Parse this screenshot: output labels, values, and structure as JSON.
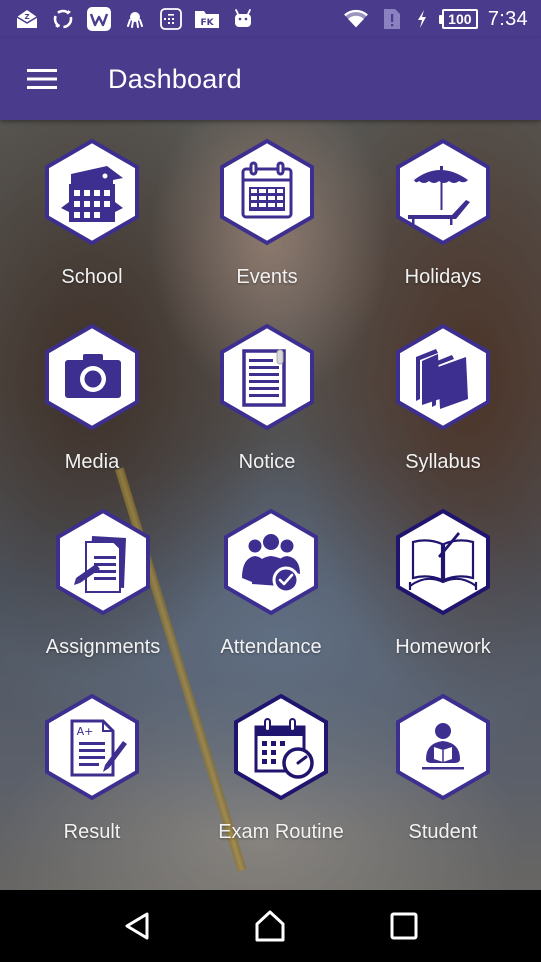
{
  "status_bar": {
    "time": "7:34",
    "battery_level": "100",
    "left_icons": [
      "mail-sync-icon",
      "sync-icon",
      "wps-office-icon",
      "octopus-icon",
      "calculator-icon",
      "fk-folder-icon",
      "android-icon"
    ],
    "right_icons": [
      "wifi-icon",
      "no-sim-icon",
      "charging-icon",
      "battery-icon"
    ]
  },
  "app_bar": {
    "title": "Dashboard",
    "menu_icon": "hamburger-menu-icon"
  },
  "theme": {
    "primary": "#4a3b8c",
    "icon_color": "#3d2f8f",
    "hex_fill": "#ffffff"
  },
  "dashboard": {
    "tiles": [
      {
        "label": "School",
        "icon": "school-building-icon"
      },
      {
        "label": "Events",
        "icon": "calendar-icon"
      },
      {
        "label": "Holidays",
        "icon": "beach-umbrella-icon"
      },
      {
        "label": "Media",
        "icon": "camera-icon"
      },
      {
        "label": "Notice",
        "icon": "notice-clipboard-icon"
      },
      {
        "label": "Syllabus",
        "icon": "books-icon"
      },
      {
        "label": "Assignments",
        "icon": "assignment-pencil-icon"
      },
      {
        "label": "Attendance",
        "icon": "attendance-group-check-icon"
      },
      {
        "label": "Homework",
        "icon": "open-book-pen-icon"
      },
      {
        "label": "Result",
        "icon": "result-grade-icon"
      },
      {
        "label": "Exam Routine",
        "icon": "calendar-clock-icon"
      },
      {
        "label": "Student",
        "icon": "student-reading-icon"
      }
    ]
  },
  "nav_bar": {
    "back": "back-icon",
    "home": "home-icon",
    "recents": "recents-icon"
  }
}
